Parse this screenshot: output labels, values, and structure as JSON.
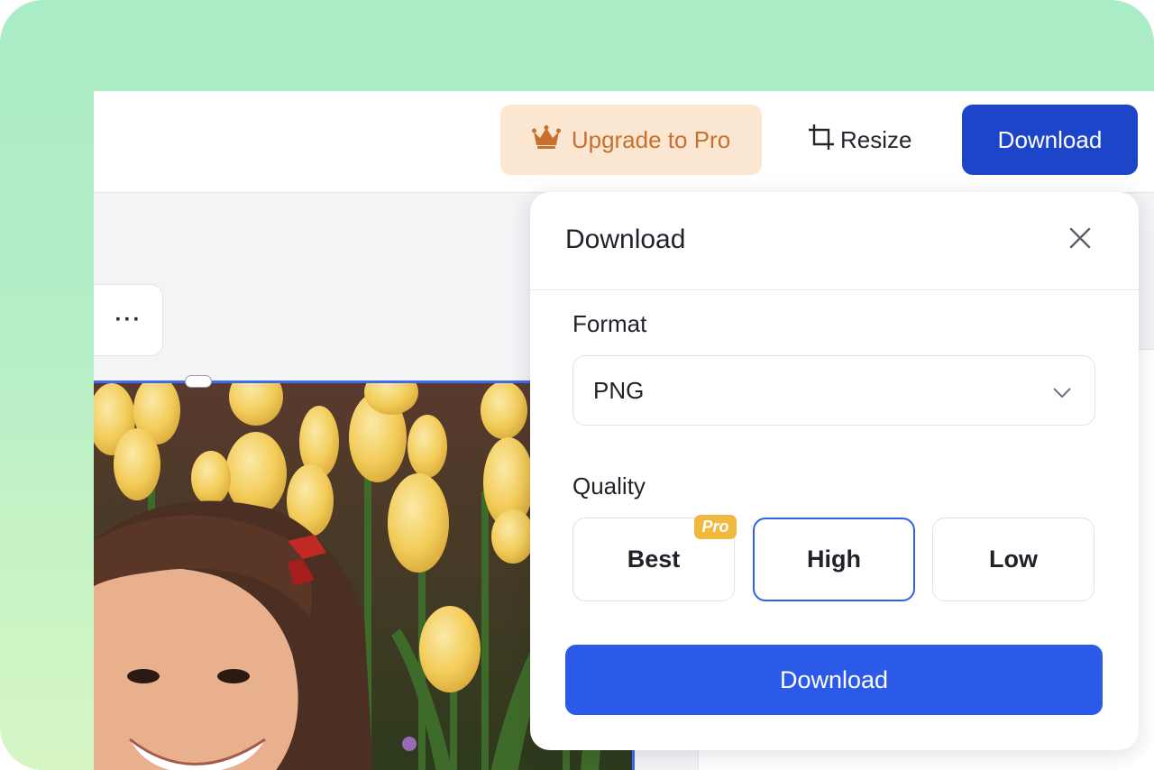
{
  "colors": {
    "frame_gradient_top": "#a9ecc6",
    "frame_gradient_bottom": "#d6f6c4",
    "upgrade_bg": "#fbe6d2",
    "upgrade_text": "#c8702e",
    "primary": "#1d45c9",
    "primary_button": "#2b5ae8",
    "selection_border": "#2f62e6",
    "pro_badge": "#f0b93d"
  },
  "topbar": {
    "upgrade_label": "Upgrade to Pro",
    "upgrade_icon": "crown-icon",
    "resize_label": "Resize",
    "resize_icon": "crop-icon",
    "download_label": "Download"
  },
  "canvas": {
    "more_label": "···",
    "photo_description": "photo-of-girl-in-tulip-field"
  },
  "dialog": {
    "title": "Download",
    "close_icon": "close-icon",
    "format": {
      "label": "Format",
      "value": "PNG",
      "icon": "chevron-down-icon"
    },
    "quality": {
      "label": "Quality",
      "options": [
        {
          "label": "Best",
          "badge": "Pro",
          "selected": false
        },
        {
          "label": "High",
          "badge": "",
          "selected": true
        },
        {
          "label": "Low",
          "badge": "",
          "selected": false
        }
      ]
    },
    "download_label": "Download"
  }
}
